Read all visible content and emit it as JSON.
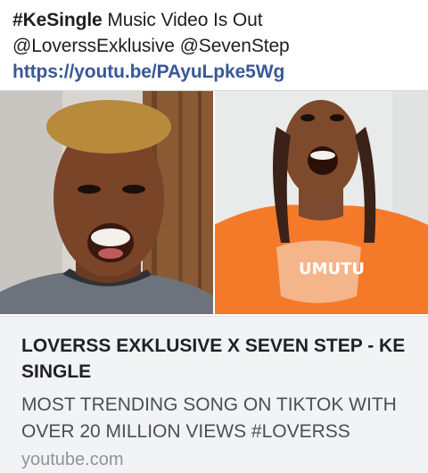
{
  "post": {
    "hashtag": "#KeSingle",
    "line1_rest": " Music Video Is Out",
    "line2": "@LoverssExklusive @SevenStep",
    "link": "https://youtu.be/PAyuLpke5Wg"
  },
  "card": {
    "title": "LOVERSS EXKLUSIVE X SEVEN STEP - KE SINGLE",
    "description": "MOST TRENDING SONG ON TIKTOK WITH OVER 20 MILLION VIEWS #LOVERSS",
    "domain": "youtube.com",
    "shirt_text": "UMUTU"
  },
  "colors": {
    "link": "#385898",
    "card_bg": "#f2f3f5",
    "shirt_orange": "#f47a2a"
  }
}
